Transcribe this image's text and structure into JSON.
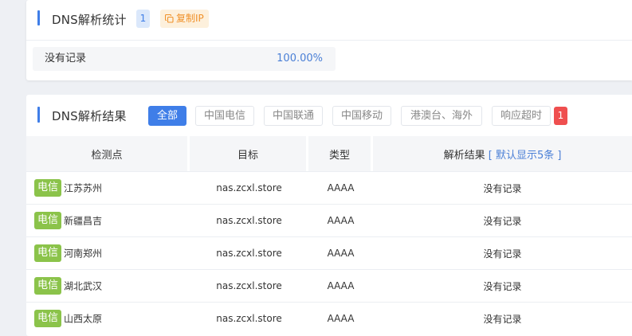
{
  "stats": {
    "title": "DNS解析统计",
    "count": "1",
    "copy_label": "复制IP",
    "rows": [
      {
        "label": "没有记录",
        "value": "100.00%"
      }
    ]
  },
  "results": {
    "title": "DNS解析结果",
    "filters": [
      "全部",
      "中国电信",
      "中国联通",
      "中国移动",
      "港澳台、海外",
      "响应超时"
    ],
    "active_filter": "全部",
    "timeout_count": "1",
    "columns": {
      "location": "检测点",
      "target": "目标",
      "type": "类型",
      "result": "解析结果",
      "result_hint_open": "[",
      "result_hint": "默认显示5条",
      "result_hint_close": "]"
    },
    "rows": [
      {
        "isp": "电信",
        "city": "江苏苏州",
        "target": "nas.zcxl.store",
        "type": "AAAA",
        "result": "没有记录"
      },
      {
        "isp": "电信",
        "city": "新疆昌吉",
        "target": "nas.zcxl.store",
        "type": "AAAA",
        "result": "没有记录"
      },
      {
        "isp": "电信",
        "city": "河南郑州",
        "target": "nas.zcxl.store",
        "type": "AAAA",
        "result": "没有记录"
      },
      {
        "isp": "电信",
        "city": "湖北武汉",
        "target": "nas.zcxl.store",
        "type": "AAAA",
        "result": "没有记录"
      },
      {
        "isp": "电信",
        "city": "山西太原",
        "target": "nas.zcxl.store",
        "type": "AAAA",
        "result": "没有记录"
      }
    ]
  },
  "colors": {
    "accent": "#3f7ee8",
    "isp_badge": "#8bc34a",
    "error_badge": "#ef4f4f",
    "copy_text": "#f0912a"
  }
}
